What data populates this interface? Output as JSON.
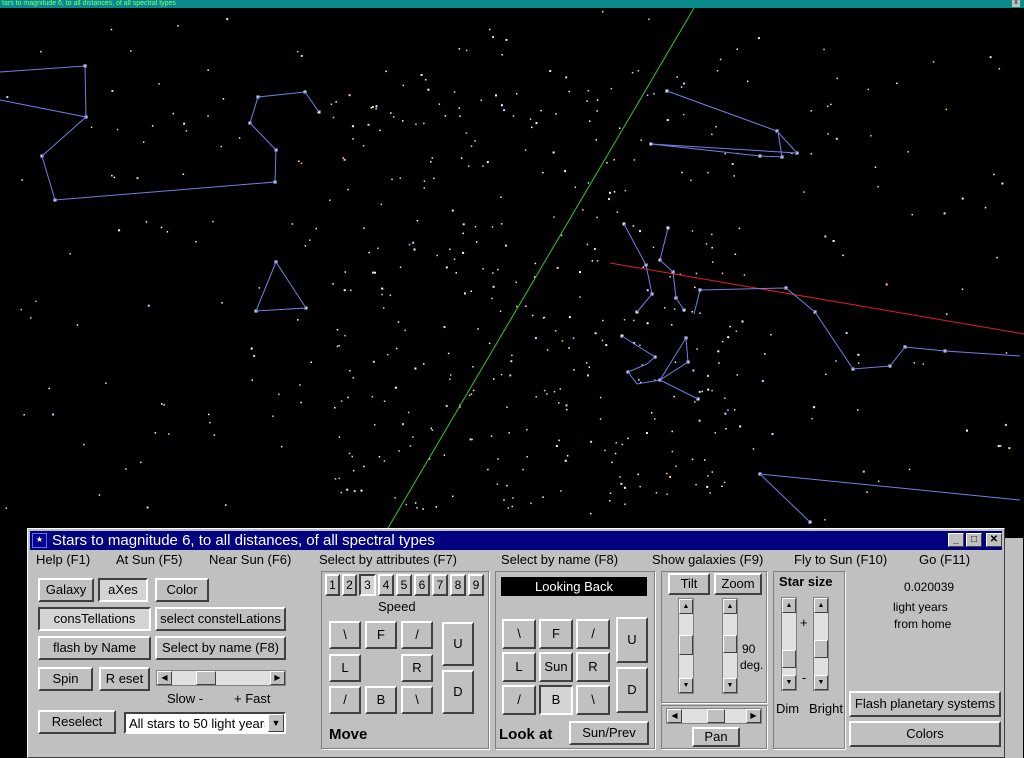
{
  "top_bar": {
    "text": "tars to magnitude 6, to all distances, of all spectral types",
    "close": "x"
  },
  "window": {
    "title": "Stars to magnitude 6, to all distances, of all spectral types",
    "title_buttons": {
      "minimize": "_",
      "maximize": "□",
      "close": "✕"
    }
  },
  "menu": {
    "help": "Help (F1)",
    "at_sun": "At Sun (F5)",
    "near_sun": "Near Sun (F6)",
    "select_attributes": "Select by attributes (F7)",
    "select_name": "Select by name (F8)",
    "show_galaxies": "Show galaxies (F9)",
    "fly_sun": "Fly to Sun (F10)",
    "go": "Go (F11)"
  },
  "left_panel": {
    "galaxy": "Galaxy",
    "axes": "aXes",
    "color": "Color",
    "constellations": "consTellations",
    "select_constellations": "select constelLations",
    "flash_by_name": "flash by Name",
    "select_by_name": "Select by name  (F8)",
    "spin": "Spin",
    "reset": "R eset",
    "slow": "Slow  -",
    "fast": "+ Fast",
    "spin_speed_fraction": 0.3,
    "reselect": "Reselect",
    "filter_value": "All stars to 50 light years"
  },
  "move": {
    "speeds": [
      "1",
      "2",
      "3",
      "4",
      "5",
      "6",
      "7",
      "8",
      "9"
    ],
    "selected_speed": "3",
    "speed_label": "Speed",
    "backslash": "\\",
    "forward": "F",
    "slash": "/",
    "left": "L",
    "right": "R",
    "back": "B",
    "up": "U",
    "down": "D",
    "label": "Move"
  },
  "look": {
    "status": "Looking Back",
    "backslash": "\\",
    "forward": "F",
    "slash": "/",
    "left": "L",
    "sun": "Sun",
    "right": "R",
    "back": "B",
    "up": "U",
    "down": "D",
    "label": "Look at",
    "sun_prev": "Sun/Prev"
  },
  "view": {
    "tilt": "Tilt",
    "zoom": "Zoom",
    "zoom_value": "90",
    "zoom_unit": "deg.",
    "pan": "Pan"
  },
  "star_size": {
    "title": "Star size",
    "plus": "+",
    "minus": "-",
    "dim": "Dim",
    "bright": "Bright"
  },
  "distance": {
    "value": "0.020039",
    "unit": "light years",
    "from": "from home"
  },
  "buttons": {
    "flash_planetary": "Flash planetary systems",
    "colors": "Colors"
  },
  "colors": {
    "sky": "#000000",
    "constellation": "#7080e8",
    "galactic_axis": "#2ec82e",
    "ecliptic_axis": "#e02020",
    "titlebar": "#000080",
    "panel": "#c0c0c0"
  }
}
